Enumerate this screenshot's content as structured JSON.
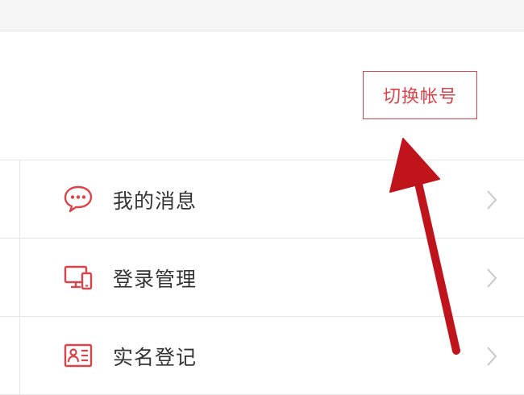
{
  "account": {
    "switch_label": "切换帐号"
  },
  "menu": {
    "items": [
      {
        "label": "我的消息",
        "icon": "chat-bubble-icon"
      },
      {
        "label": "登录管理",
        "icon": "devices-icon"
      },
      {
        "label": "实名登记",
        "icon": "id-card-icon"
      }
    ]
  },
  "colors": {
    "accent": "#d9444a",
    "annotation_arrow": "#c0141c",
    "chevron": "#c8c8c8",
    "text": "#333333"
  }
}
